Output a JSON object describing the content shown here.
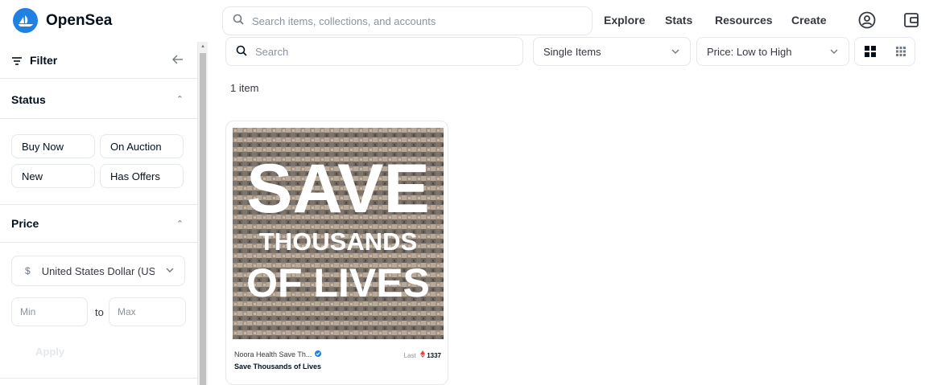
{
  "header": {
    "brand": "OpenSea",
    "search_placeholder": "Search items, collections, and accounts",
    "nav": [
      "Explore",
      "Stats",
      "Resources",
      "Create"
    ]
  },
  "sidebar": {
    "filter_label": "Filter",
    "status": {
      "title": "Status",
      "options": [
        "Buy Now",
        "On Auction",
        "New",
        "Has Offers"
      ]
    },
    "price": {
      "title": "Price",
      "currency_symbol": "$",
      "currency": "United States Dollar (USD)",
      "min_placeholder": "Min",
      "to_label": "to",
      "max_placeholder": "Max",
      "apply_label": "Apply"
    }
  },
  "main": {
    "search_placeholder": "Search",
    "items_filter": "Single Items",
    "sort": "Price: Low to High",
    "count_label": "1 item",
    "card": {
      "art_line1": "SAVE",
      "art_line2": "THOUSANDS",
      "art_line3": "OF LIVES",
      "collection": "Noora Health Save Th...",
      "name": "Save Thousands of Lives",
      "last_label": "Last",
      "last_price": "1337"
    }
  },
  "colors": {
    "brand_blue": "#2081e2",
    "eth_red": "#e84142"
  }
}
